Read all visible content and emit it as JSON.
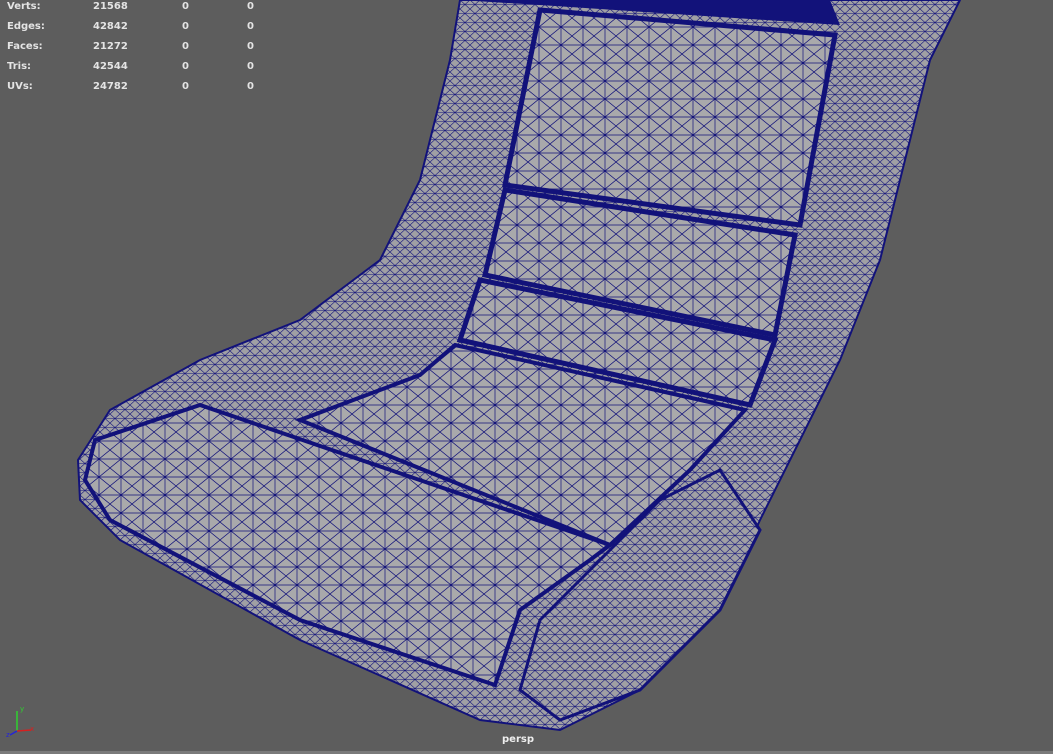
{
  "hud": {
    "rows": [
      {
        "label": "Verts:",
        "total": "21568",
        "selected": "0",
        "third": "0"
      },
      {
        "label": "Edges:",
        "total": "42842",
        "selected": "0",
        "third": "0"
      },
      {
        "label": "Faces:",
        "total": "21272",
        "selected": "0",
        "third": "0"
      },
      {
        "label": "Tris:",
        "total": "42544",
        "selected": "0",
        "third": "0"
      },
      {
        "label": "UVs:",
        "total": "24782",
        "selected": "0",
        "third": "0"
      }
    ]
  },
  "camera": "persp",
  "axis": {
    "x": "x",
    "y": "y",
    "z": "z"
  },
  "colors": {
    "background": "#5d5d5d",
    "wireframe": "#12127a",
    "surface": "#a9a9a9"
  }
}
